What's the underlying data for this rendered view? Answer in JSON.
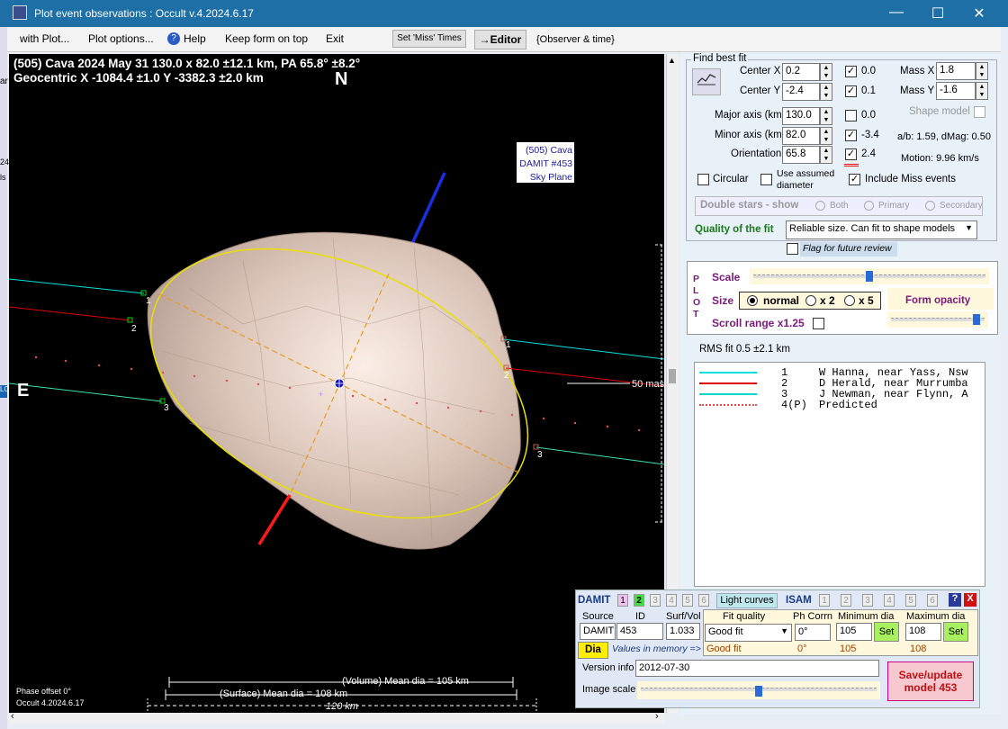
{
  "window": {
    "title": "Plot event observations : Occult v.4.2024.6.17",
    "min": "—",
    "max": "☐",
    "close": "✕"
  },
  "menu": {
    "with_plot": "with Plot...",
    "plot_options": "Plot options...",
    "help": "Help",
    "keep_on_top": "Keep form on top",
    "exit": "Exit",
    "set_miss": "Set 'Miss' Times",
    "editor": "→Editor",
    "observer_time": "{Observer & time}"
  },
  "plot": {
    "header1": "(505) Cava  2024 May 31   130.0 x 82.0 ±12.1 km, PA 65.8° ±8.2°",
    "header2": "Geocentric  X  -1084.4 ±1.0  Y -3382.3 ±2.0 km",
    "north": "N",
    "east": "E",
    "model_label": [
      "(505) Cava",
      "DAMIT #453",
      "Sky Plane"
    ],
    "chord_labels": [
      "1",
      "2",
      "3"
    ],
    "mas_label": "50 mas",
    "mean_vol": "(Volume) Mean dia = 105 km",
    "mean_surf": "(Surface) Mean dia = 108 km",
    "scale_km": "120 km",
    "phase_offset": "Phase offset 0°",
    "version": "Occult 4.2024.6.17",
    "left_edge": [
      "ar",
      "24",
      "ls",
      "LO"
    ]
  },
  "fit": {
    "title": "Find best fit",
    "center_x": {
      "label": "Center X",
      "value": "0.2",
      "check_val": "0.0"
    },
    "center_y": {
      "label": "Center Y",
      "value": "-2.4",
      "check_val": "0.1"
    },
    "major": {
      "label": "Major axis (km)",
      "value": "130.0",
      "check_val": "0.0"
    },
    "minor": {
      "label": "Minor axis (km)",
      "value": "82.0",
      "check_val": "-3.4"
    },
    "orient": {
      "label": "Orientation",
      "value": "65.8",
      "check_val": "2.4"
    },
    "mass_x": {
      "label": "Mass X",
      "value": "1.8"
    },
    "mass_y": {
      "label": "Mass Y",
      "value": "-1.6"
    },
    "shape_model": "Shape model",
    "ab": "a/b: 1.59, dMag: 0.50",
    "motion": "Motion: 9.96 km/s",
    "circular": "Circular",
    "use_assumed": [
      "Use assumed",
      "diameter"
    ],
    "include_miss": "Include Miss events",
    "double_stars": "Double stars - show",
    "both": "Both",
    "primary": "Primary",
    "secondary": "Secondary",
    "quality_label": "Quality of the fit",
    "quality_value": "Reliable size. Can fit to shape models",
    "flag": "Flag for future review"
  },
  "plotpanel": {
    "letters": [
      "P",
      "L",
      "O",
      "T"
    ],
    "scale": "Scale",
    "size": "Size",
    "normal": "normal",
    "x2": "x 2",
    "x5": "x 5",
    "form_opacity": "Form opacity",
    "scroll_range": "Scroll range x1.25",
    "scale_level": 0.5,
    "opacity_level": 0.95
  },
  "rms": "RMS fit 0.5 ±2.1 km",
  "legend": [
    {
      "num": "1",
      "name": "W Hanna, near Yass, Nsw",
      "color": "#00e0e0",
      "style": "solid"
    },
    {
      "num": "2",
      "name": "D Herald, near Murrumba",
      "color": "#e00000",
      "style": "solid"
    },
    {
      "num": "3",
      "name": "J Newman, near Flynn, A",
      "color": "#00d8c8",
      "style": "solid"
    },
    {
      "num": "4(P)",
      "name": "Predicted",
      "color": "#e05050",
      "style": "dotted"
    }
  ],
  "damit": {
    "damit": "DAMIT",
    "isam": "ISAM",
    "tabs": [
      "1",
      "2",
      "3",
      "4",
      "5",
      "6"
    ],
    "light_curves": "Light curves",
    "source_h": "Source",
    "id_h": "ID",
    "surf_h": "Surf/Vol",
    "source": "DAMIT",
    "id": "453",
    "surf": "1.033",
    "fitq_h": "Fit quality",
    "phcorr_h": "Ph Corrn",
    "mindia_h": "Minimum dia",
    "maxdia_h": "Maximum dia",
    "fitq": "Good fit",
    "phcorr": "0°",
    "mindia": "105",
    "maxdia": "108",
    "set": "Set",
    "dia": "Dia",
    "values_mem": "Values in memory =>",
    "mem_fit": "Good fit",
    "mem_ph": "0°",
    "mem_min": "105",
    "mem_max": "108",
    "version_label": "Version info",
    "version": "2012-07-30",
    "image_scale": "Image scale",
    "image_scale_level": 0.5,
    "save": [
      "Save/update",
      "model 453"
    ]
  }
}
